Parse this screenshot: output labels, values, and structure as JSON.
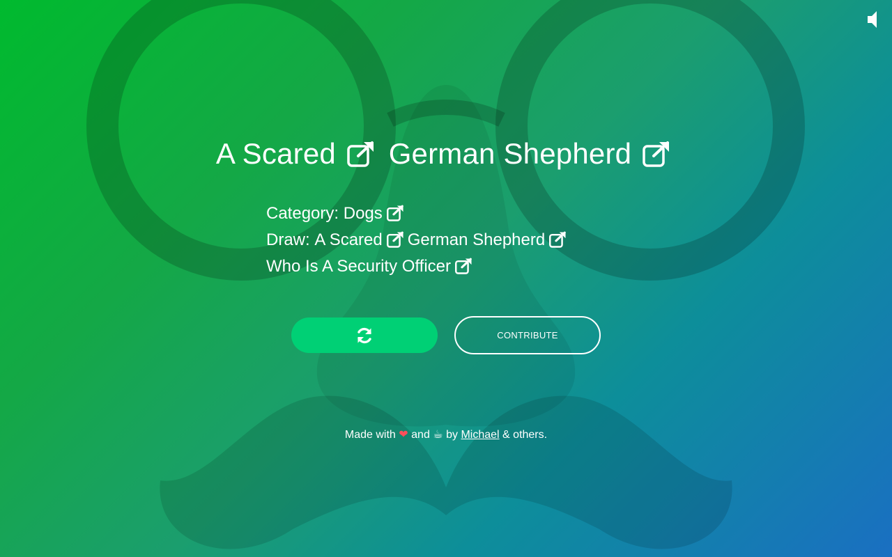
{
  "title": {
    "part1": "A Scared",
    "part2": "German Shepherd"
  },
  "details": {
    "category_label": "Category:",
    "category_value": "Dogs",
    "draw_label": "Draw:",
    "draw_part1": "A Scared",
    "draw_part2": "German Shepherd",
    "draw_part3": "Who Is A Security Officer"
  },
  "buttons": {
    "refresh_icon": "refresh-icon",
    "contribute_label": "CONTRIBUTE"
  },
  "footer": {
    "made_with": "Made with",
    "heart": "❤",
    "and": "and",
    "coffee": "☕",
    "by": "by",
    "author": "Michael",
    "others": "& others."
  },
  "icons": {
    "sound": "speaker-icon",
    "external": "external-link-icon"
  },
  "colors": {
    "refresh_button": "#00d075",
    "heart": "#ff4e5a"
  }
}
